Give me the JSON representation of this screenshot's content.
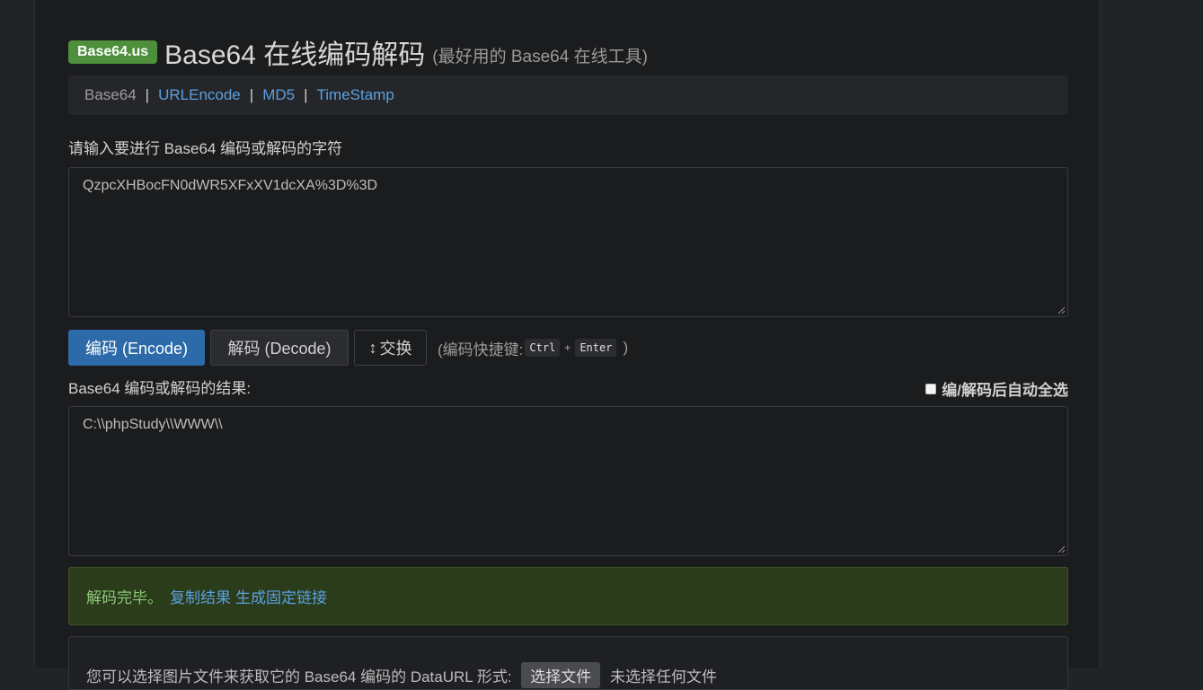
{
  "header": {
    "badge": "Base64.us",
    "title": "Base64 在线编码解码",
    "subtitle": "(最好用的 Base64 在线工具)"
  },
  "nav": {
    "items": [
      {
        "label": "Base64",
        "active": true
      },
      {
        "label": "URLEncode",
        "active": false
      },
      {
        "label": "MD5",
        "active": false
      },
      {
        "label": "TimeStamp",
        "active": false
      }
    ],
    "separator": "|"
  },
  "input": {
    "label": "请输入要进行 Base64 编码或解码的字符",
    "value": "QzpcXHBocFN0dWR5XFxXV1dcXA%3D%3D"
  },
  "actions": {
    "encode_label": "编码 (Encode)",
    "decode_label": "解码 (Decode)",
    "swap_label": "交换",
    "shortcut_prefix": "(编码快捷键:",
    "key_ctrl": "Ctrl",
    "key_plus": "+",
    "key_enter": "Enter",
    "shortcut_suffix": ")"
  },
  "output": {
    "label": "Base64 编码或解码的结果:",
    "auto_select_label": "编/解码后自动全选",
    "value": "C:\\\\phpStudy\\\\WWW\\\\"
  },
  "alert": {
    "status": "解码完毕。",
    "copy_link": "复制结果",
    "permalink": "生成固定链接"
  },
  "file_panel": {
    "text_before": "您可以选择图片文件来获取它的 Base64 编码的 DataURL 形式:",
    "button": "选择文件",
    "text_after": "未选择任何文件"
  },
  "colors": {
    "badge": "#4e8f3b",
    "primary_button": "#2d6aa9",
    "link": "#5aa0e0",
    "alert_bg": "#2b3c1b"
  }
}
